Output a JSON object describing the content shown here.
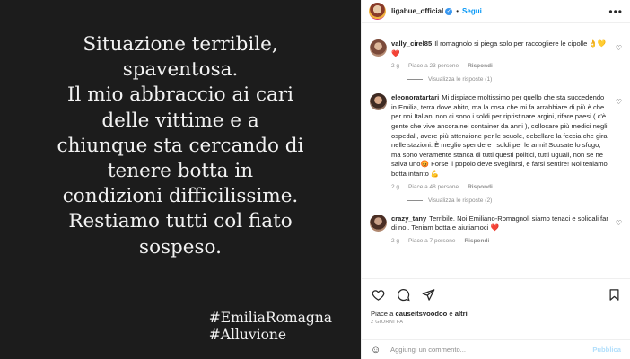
{
  "post": {
    "text": "Situazione terribile,\nspaventosa.\nIl mio abbraccio ai cari\ndelle vittime e a\nchiunque sta cercando di\ntenere botta in\ncondizioni difficilissime.\nRestiamo tutti col fiato\nsospeso.",
    "hashtags": [
      "#EmiliaRomagna",
      "#Alluvione"
    ]
  },
  "header": {
    "username": "ligabue_official",
    "separator": "•",
    "follow_label": "Segui",
    "more_icon": "more-horizontal-icon"
  },
  "comments": [
    {
      "username": "vally_cirel85",
      "text": "Il romagnolo si piega solo per raccogliere le cipolle 👌💛❤️",
      "age": "2 g",
      "likes": "Piace a 23 persone",
      "reply_label": "Rispondi",
      "view_replies": "Visualizza le risposte (1)"
    },
    {
      "username": "eleonoratartari",
      "text": "Mi dispiace moltissimo per quello che sta succedendo in Emilia, terra dove abito, ma la cosa che mi fa arrabbiare di più è che per noi Italiani non ci sono i soldi per ripristinare argini, rifare paesi ( c'è gente che vive ancora nei container da anni ), collocare più medici negli ospedali, avere più attenzione per le scuole, debellare la feccia che gira nelle stazioni. È meglio spendere i soldi per le armi! Scusate lo sfogo, ma sono veramente stanca di tutti questi politici, tutti uguali, non se ne salva uno😡 Forse il popolo deve svegliarsi, e farsi sentire! Noi teniamo botta intanto 💪",
      "age": "2 g",
      "likes": "Piace a 48 persone",
      "reply_label": "Rispondi",
      "view_replies": "Visualizza le risposte (2)"
    },
    {
      "username": "crazy_tany",
      "text": "Terribile. Noi Emiliano-Romagnoli siamo tenaci e solidali far di noi. Teniam botta e aiutiamoci ❤️",
      "age": "2 g",
      "likes": "Piace a 7 persone",
      "reply_label": "Rispondi"
    }
  ],
  "footer": {
    "likes_prefix": "Piace a",
    "likes_user": "causeitsvoodoo",
    "likes_suffix": "e",
    "likes_others": "altri",
    "date": "2 GIORNI FA",
    "comment_placeholder": "Aggiungi un commento...",
    "publish_label": "Pubblica"
  },
  "colors": {
    "accent": "#0095f6",
    "post_background": "#1c1c1c",
    "like_red": "#ed4956"
  }
}
